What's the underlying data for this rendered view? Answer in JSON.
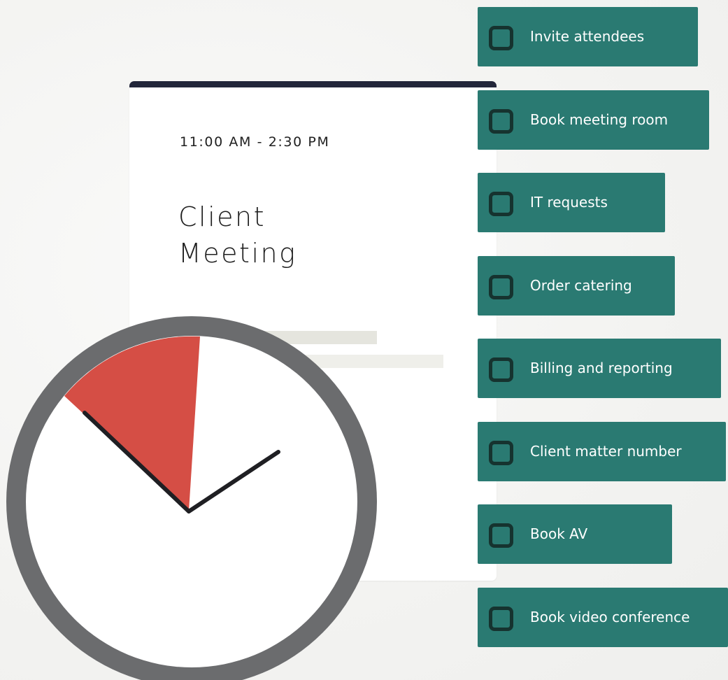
{
  "event": {
    "time": "11:00 AM - 2:30 PM",
    "title_line1": "Client",
    "title_line2": "Meeting"
  },
  "tasks": [
    {
      "label": "Invite attendees"
    },
    {
      "label": "Book meeting room"
    },
    {
      "label": "IT requests"
    },
    {
      "label": "Order catering"
    },
    {
      "label": "Billing and reporting"
    },
    {
      "label": "Client matter number"
    },
    {
      "label": "Book AV"
    },
    {
      "label": "Book video conference"
    }
  ],
  "colors": {
    "task_bg": "#2a7a72",
    "checkbox_border": "#16332f",
    "card_topbar": "#22263a",
    "clock_ring": "#6b6c6e",
    "clock_sector": "#d54e45",
    "clock_hands": "#1f1f23"
  }
}
